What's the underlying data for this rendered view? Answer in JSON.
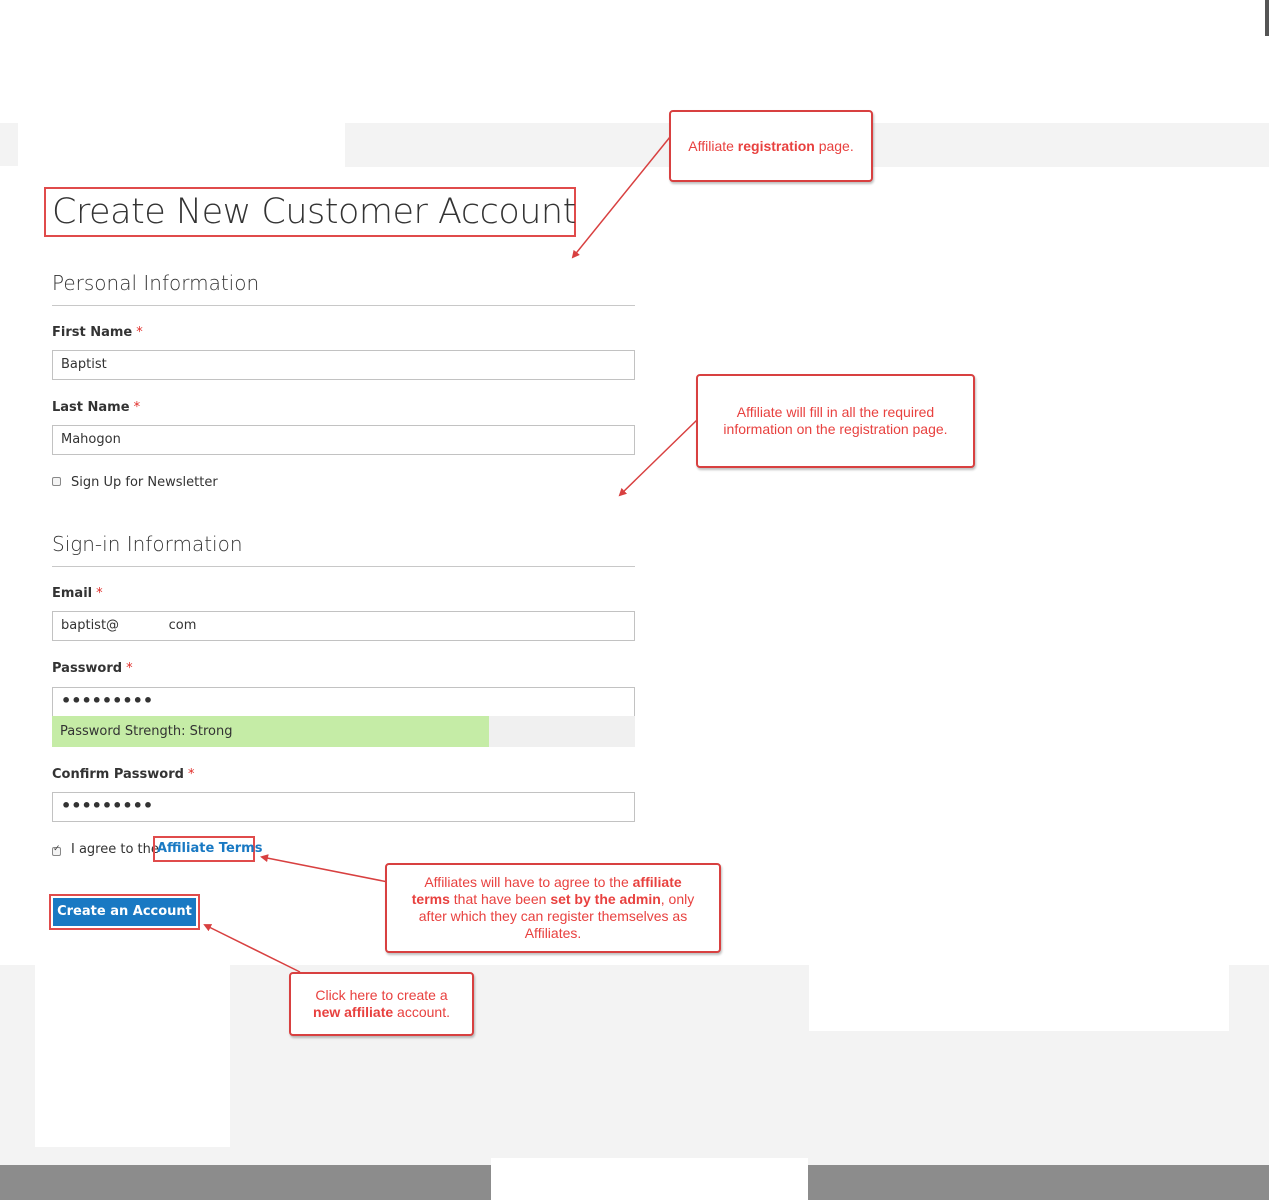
{
  "page": {
    "title": "Create New Customer Account"
  },
  "personal": {
    "heading": "Personal Information",
    "first_name_label": "First Name",
    "first_name_value": "Baptist",
    "last_name_label": "Last Name",
    "last_name_value": "Mahogon",
    "newsletter_label": "Sign Up for Newsletter",
    "required_mark": "*"
  },
  "signin": {
    "heading": "Sign-in Information",
    "email_label": "Email",
    "email_value": "baptist@            com",
    "password_label": "Password",
    "password_value": "•••••••••",
    "strength_text": "Password Strength: Strong",
    "strength_fraction": 0.75,
    "confirm_label": "Confirm Password",
    "confirm_value": "•••••••••"
  },
  "terms": {
    "prefix": "I agree to the",
    "link": "Affiliate Terms",
    "checked": true
  },
  "submit": {
    "label": "Create an Account",
    "color": "#1979c3"
  },
  "callouts": {
    "registration": {
      "pre": "Affiliate ",
      "bold": "registration",
      "post": " page."
    },
    "fill_info": {
      "line1": "Affiliate will fill in all the required",
      "line2": "information on the registration page."
    },
    "terms": {
      "p1": "Affiliates will have to agree to the ",
      "b1": "affiliate",
      "b2": "terms",
      "p2": " that have been ",
      "b3": "set by the admin",
      "p3": ", only after which they can register themselves as Affiliates."
    },
    "create": {
      "line1": "Click here to create a",
      "bold": "new affiliate",
      "post": " account."
    }
  },
  "colors": {
    "annotation": "#e8413f",
    "strength_fill": "#c5eca6",
    "link": "#1979c3"
  }
}
